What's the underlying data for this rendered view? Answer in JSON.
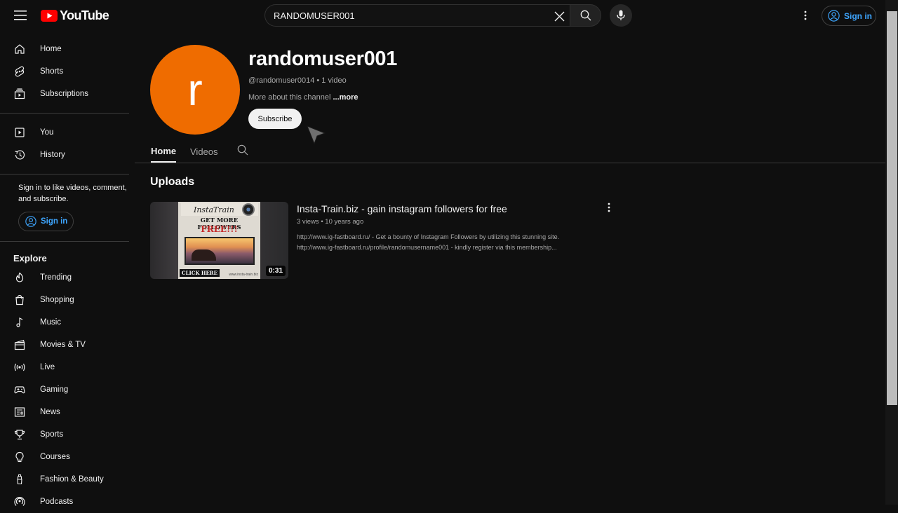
{
  "header": {
    "logo_text": "YouTube",
    "search_value": "RANDOMUSER001",
    "signin_label": "Sign in"
  },
  "sidebar": {
    "primary": [
      {
        "label": "Home",
        "icon": "home-icon"
      },
      {
        "label": "Shorts",
        "icon": "shorts-icon"
      },
      {
        "label": "Subscriptions",
        "icon": "subscriptions-icon"
      }
    ],
    "secondary": [
      {
        "label": "You",
        "icon": "you-icon"
      },
      {
        "label": "History",
        "icon": "history-icon"
      }
    ],
    "signin_message": "Sign in to like videos, comment, and subscribe.",
    "signin_label": "Sign in",
    "explore_title": "Explore",
    "explore": [
      {
        "label": "Trending",
        "icon": "trending-icon"
      },
      {
        "label": "Shopping",
        "icon": "shopping-icon"
      },
      {
        "label": "Music",
        "icon": "music-icon"
      },
      {
        "label": "Movies & TV",
        "icon": "movies-icon"
      },
      {
        "label": "Live",
        "icon": "live-icon"
      },
      {
        "label": "Gaming",
        "icon": "gaming-icon"
      },
      {
        "label": "News",
        "icon": "news-icon"
      },
      {
        "label": "Sports",
        "icon": "sports-icon"
      },
      {
        "label": "Courses",
        "icon": "courses-icon"
      },
      {
        "label": "Fashion & Beauty",
        "icon": "fashion-icon"
      },
      {
        "label": "Podcasts",
        "icon": "podcasts-icon"
      }
    ]
  },
  "channel": {
    "avatar_letter": "r",
    "avatar_color": "#ef6c00",
    "name": "randomuser001",
    "meta": "@randomuser0014 • 1 video",
    "about": "More about this channel",
    "more": "...more",
    "subscribe_label": "Subscribe"
  },
  "tabs": [
    "Home",
    "Videos"
  ],
  "uploads": {
    "title": "Uploads",
    "video": {
      "title": "Insta-Train.biz - gain instagram followers for free",
      "views": "3 views",
      "age": "10 years ago",
      "description_lines": [
        "http://www.ig-fastboard.ru/ - Get a bounty of Instagram Followers by utilizing this stunning site.",
        "http://www.ig-fastboard.ru/profile/randomusername001 - kindly register via this membership..."
      ],
      "duration": "0:31",
      "thumbnail": {
        "brand": "InstaTrain",
        "headline": "GET MORE FOLLOWERS",
        "free": "FREE!!!",
        "cta": "CLICK HERE",
        "url": "www.insta-train.biz"
      }
    }
  },
  "colors": {
    "background": "#0f0f0f",
    "accent_link": "#3ea6ff",
    "youtube_red": "#ff0000"
  }
}
